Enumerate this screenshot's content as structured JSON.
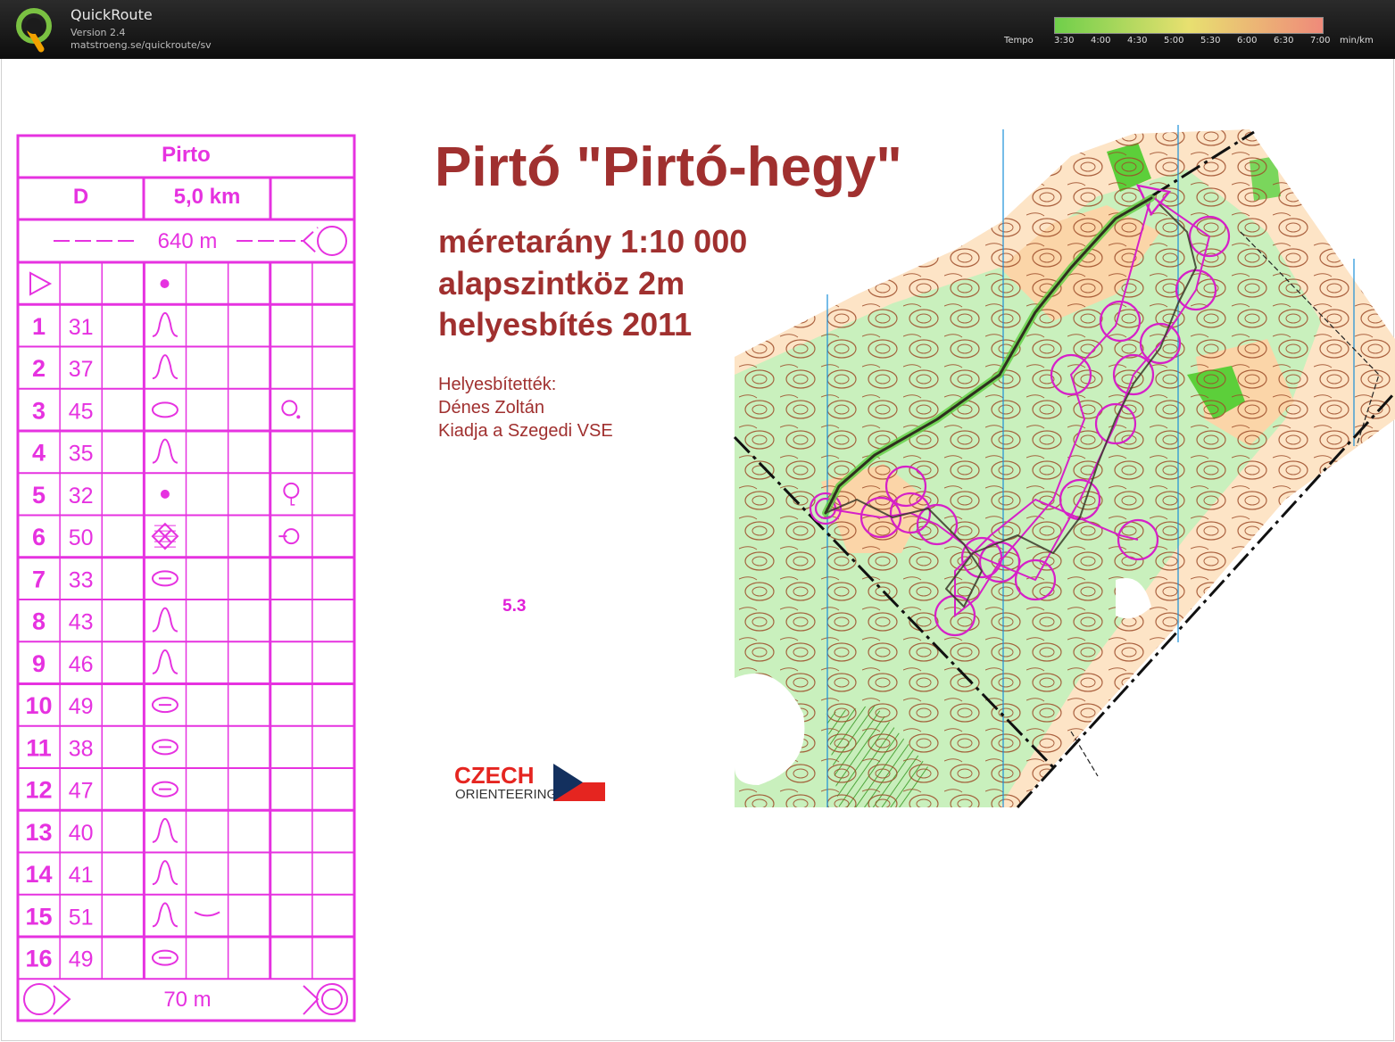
{
  "header": {
    "app_name": "QuickRoute",
    "version": "Version 2.4",
    "url": "matstroeng.se/quickroute/sv",
    "logo_icon": "quickroute-q-logo-icon",
    "tempo_label": "Tempo",
    "tempo_ticks": [
      "3:30",
      "4:00",
      "4:30",
      "5:00",
      "5:30",
      "6:00",
      "6:30",
      "7:00"
    ],
    "tempo_unit": "min/km",
    "tempo_colors": [
      "#6fcf4a",
      "#e8e070",
      "#ef8a7a"
    ]
  },
  "course": {
    "name": "Pirto",
    "class": "D",
    "length": "5,0 km",
    "start_tape": "640 m",
    "finish_tape": "70 m",
    "start_feature": "dot",
    "controls": [
      {
        "num": "1",
        "code": "31",
        "feature": "knoll"
      },
      {
        "num": "2",
        "code": "37",
        "feature": "knoll"
      },
      {
        "num": "3",
        "code": "45",
        "feature": "elongated-knoll",
        "position": "foot-south-east"
      },
      {
        "num": "4",
        "code": "35",
        "feature": "knoll"
      },
      {
        "num": "5",
        "code": "32",
        "feature": "dot",
        "position": "foot-south"
      },
      {
        "num": "6",
        "code": "50",
        "feature": "thicket",
        "position": "west-edge"
      },
      {
        "num": "7",
        "code": "33",
        "feature": "depression"
      },
      {
        "num": "8",
        "code": "43",
        "feature": "knoll"
      },
      {
        "num": "9",
        "code": "46",
        "feature": "knoll"
      },
      {
        "num": "10",
        "code": "49",
        "feature": "depression"
      },
      {
        "num": "11",
        "code": "38",
        "feature": "depression"
      },
      {
        "num": "12",
        "code": "47",
        "feature": "depression"
      },
      {
        "num": "13",
        "code": "40",
        "feature": "knoll"
      },
      {
        "num": "14",
        "code": "41",
        "feature": "knoll"
      },
      {
        "num": "15",
        "code": "51",
        "feature": "knoll",
        "detail": "shallow"
      },
      {
        "num": "16",
        "code": "49",
        "feature": "depression"
      }
    ],
    "color": "#e632e0"
  },
  "map": {
    "title": "Pirtó \"Pirtó-hegy\"",
    "scale": "méretarány 1:10 000",
    "contour": "alapszintköz 2m",
    "revision": "helyesbítés 2011",
    "credits_heading": "Helyesbítették:",
    "credits_name": "Dénes Zoltán",
    "publisher": "Kiadja a Szegedi VSE",
    "split_labels": "5.3",
    "sponsor_word": "CZECH",
    "sponsor_sub": "ORIENTEERING",
    "title_color": "#a0302f",
    "route_color": "#2f2f1f"
  }
}
